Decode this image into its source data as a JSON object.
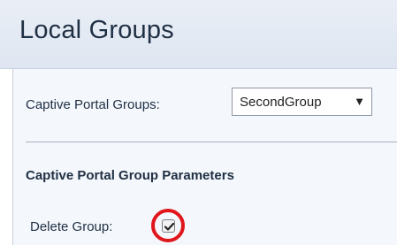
{
  "header": {
    "title": "Local Groups"
  },
  "form": {
    "captive_portal_groups_label": "Captive Portal Groups:",
    "captive_portal_groups_value": "SecondGroup",
    "parameters_heading": "Captive Portal Group Parameters",
    "delete_group_label": "Delete Group:",
    "delete_group_checked": true
  },
  "icons": {
    "dropdown": "chevron-down-icon",
    "checkmark": "check-icon"
  },
  "colors": {
    "highlight_ring": "#e0161b",
    "title_bg": "#e4eaf3",
    "text": "#1f2f44"
  }
}
